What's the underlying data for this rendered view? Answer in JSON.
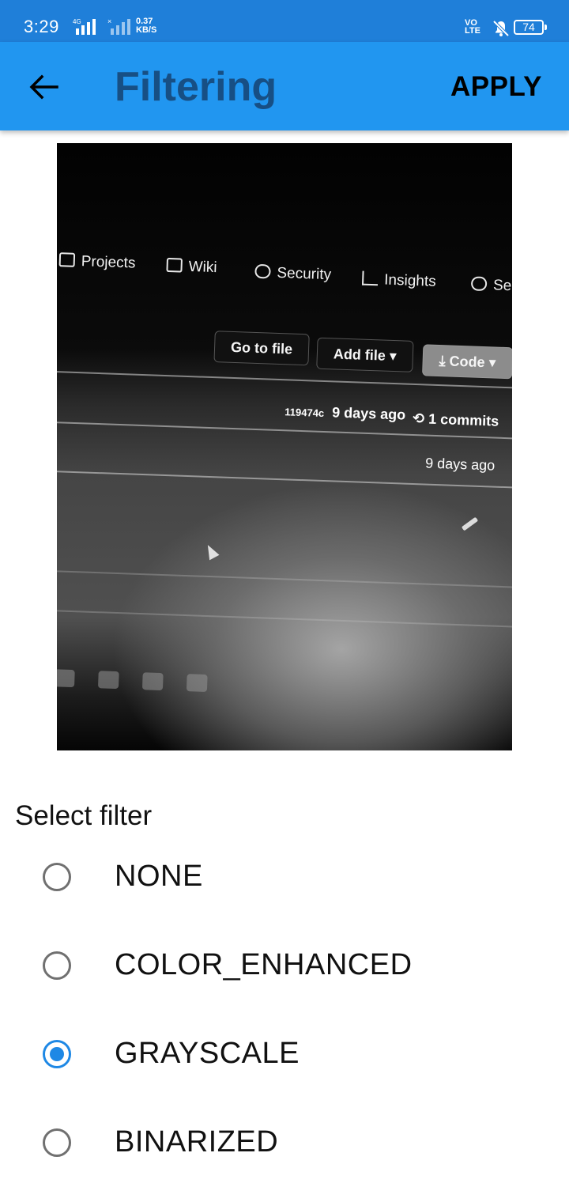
{
  "status_bar": {
    "time": "3:29",
    "network_type": "4G",
    "speed_value": "0.37",
    "speed_unit": "KB/S",
    "volte_line1": "VO",
    "volte_line2": "LTE",
    "battery": "74"
  },
  "app_bar": {
    "title": "Filtering",
    "apply_label": "APPLY",
    "back_icon": "arrow-left-icon",
    "background_color": "#2196f0",
    "title_color": "#174f84"
  },
  "preview": {
    "nav_items": [
      "Projects",
      "Wiki",
      "Security",
      "Insights",
      "Se"
    ],
    "buttons": {
      "go_to_file": "Go to file",
      "add_file": "Add file ▾",
      "code": "⤓ Code ▾"
    },
    "commit_hash": "119474c",
    "commit_time": "9 days ago",
    "commits": "1 commits",
    "row_time": "9 days ago"
  },
  "filters": {
    "heading": "Select filter",
    "options": [
      {
        "label": "NONE",
        "selected": false
      },
      {
        "label": "COLOR_ENHANCED",
        "selected": false
      },
      {
        "label": "GRAYSCALE",
        "selected": true
      },
      {
        "label": "BINARIZED",
        "selected": false
      }
    ],
    "accent_color": "#1e88e5"
  }
}
